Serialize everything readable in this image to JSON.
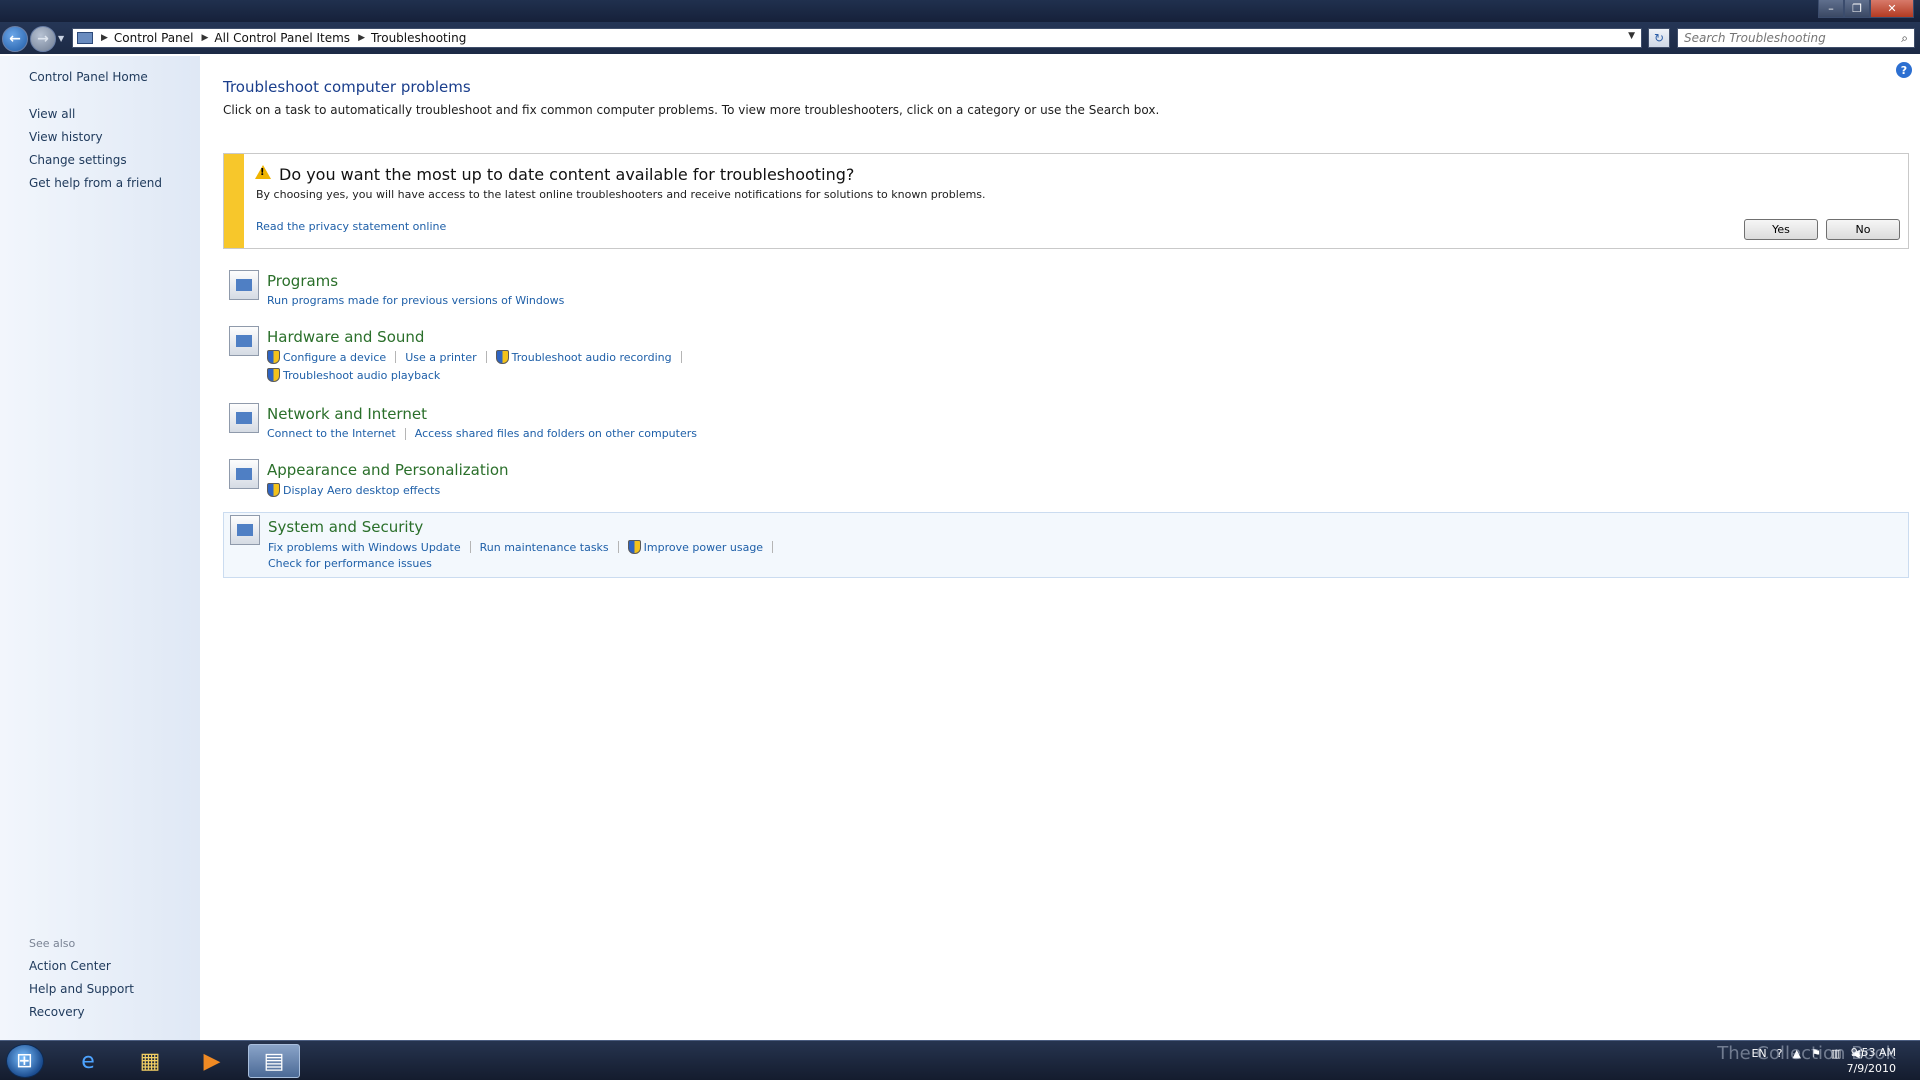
{
  "addressbar": {
    "crumbs": [
      "Control Panel",
      "All Control Panel Items",
      "Troubleshooting"
    ],
    "search_placeholder": "Search Troubleshooting"
  },
  "sidebar": {
    "home": "Control Panel Home",
    "links": [
      "View all",
      "View history",
      "Change settings",
      "Get help from a friend"
    ],
    "see_also_label": "See also",
    "see_also": [
      "Action Center",
      "Help and Support",
      "Recovery"
    ]
  },
  "main": {
    "title": "Troubleshoot computer problems",
    "description": "Click on a task to automatically troubleshoot and fix common computer problems. To view more troubleshooters, click on a category or use the Search box.",
    "banner": {
      "title": "Do you want the most up to date content available for troubleshooting?",
      "text": "By choosing yes, you will have access to the latest online troubleshooters and receive notifications for solutions to known problems.",
      "link": "Read the privacy statement online",
      "yes": "Yes",
      "no": "No"
    },
    "categories": [
      {
        "title": "Programs",
        "tasks": [
          "Run programs made for previous versions of Windows"
        ]
      },
      {
        "title": "Hardware and Sound",
        "tasks": [
          "Configure a device",
          "Use a printer",
          "Troubleshoot audio recording",
          "Troubleshoot audio playback"
        ]
      },
      {
        "title": "Network and Internet",
        "tasks": [
          "Connect to the Internet",
          "Access shared files and folders on other computers"
        ]
      },
      {
        "title": "Appearance and Personalization",
        "tasks": [
          "Display Aero desktop effects"
        ]
      },
      {
        "title": "System and Security",
        "tasks": [
          "Fix problems with Windows Update",
          "Run maintenance tasks",
          "Improve power usage",
          "Check for performance issues"
        ]
      }
    ]
  },
  "taskbar": {
    "language": "EN",
    "time": "9:53 AM",
    "date": "7/9/2010",
    "watermark": "The Collection Book"
  }
}
